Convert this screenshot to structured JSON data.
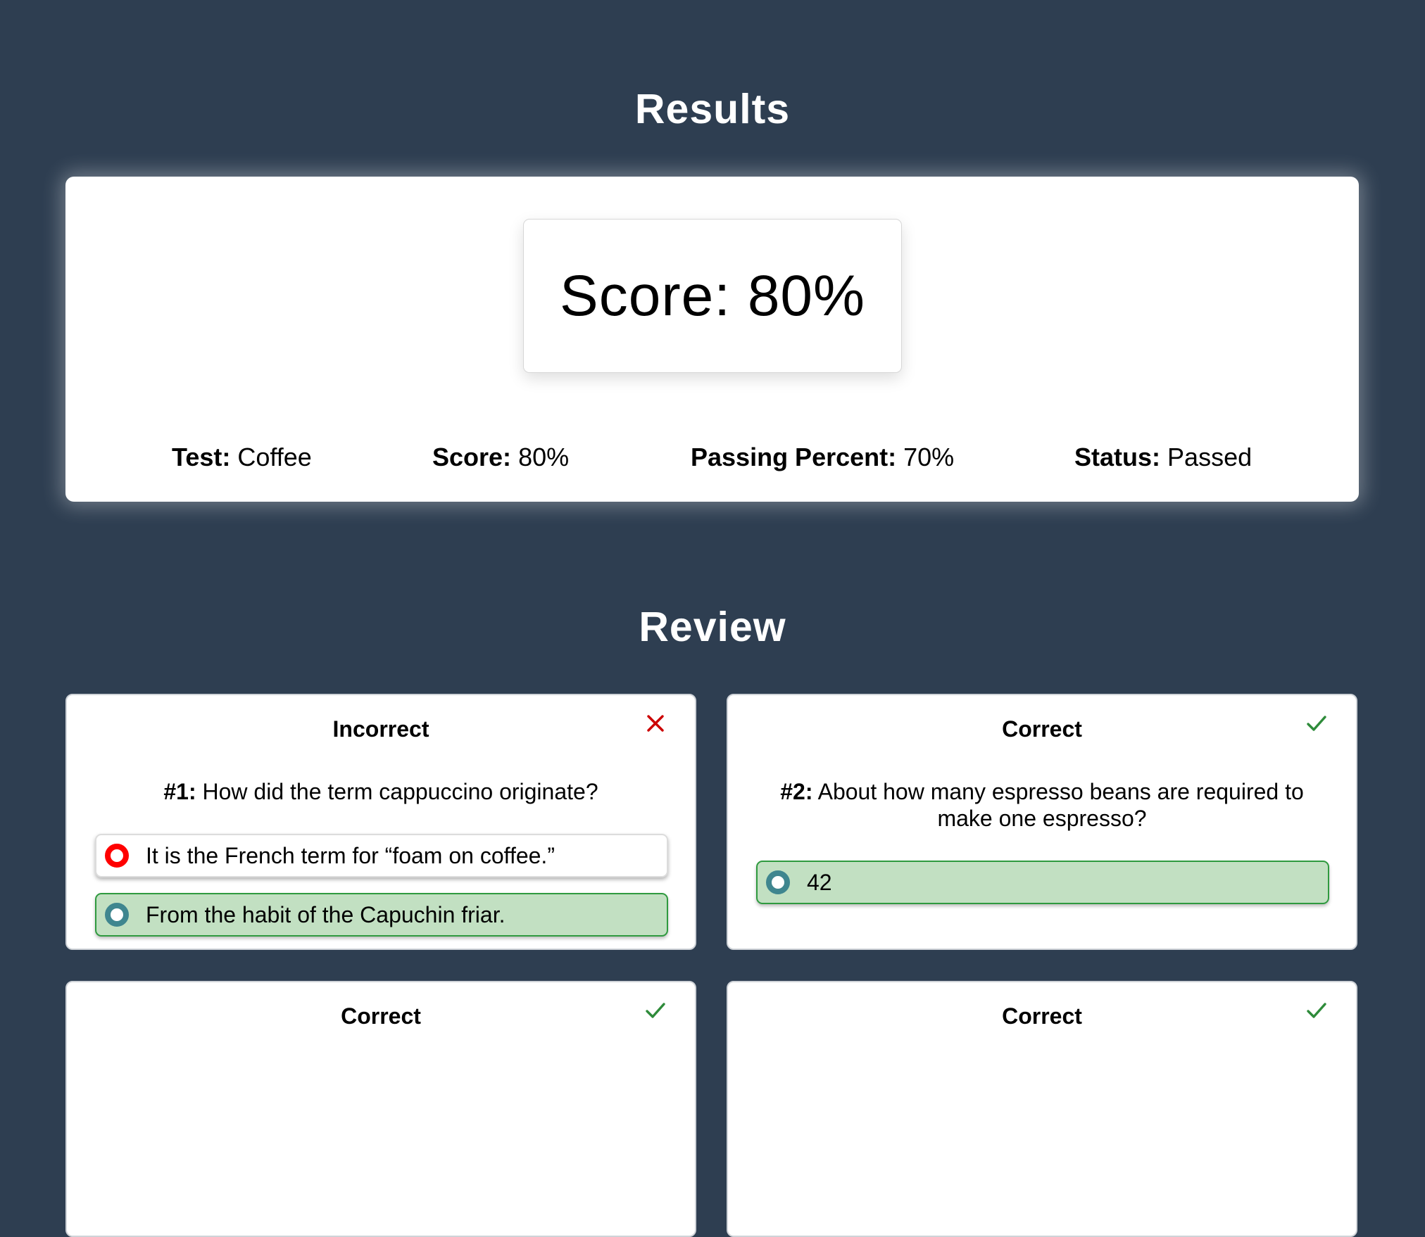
{
  "results_heading": "Results",
  "review_heading": "Review",
  "summary": {
    "score_display": "Score: 80%",
    "test_label": "Test:",
    "test_value": "Coffee",
    "score_label": "Score:",
    "score_value": "80%",
    "passing_label": "Passing Percent:",
    "passing_value": "70%",
    "status_label": "Status:",
    "status_value": "Passed"
  },
  "questions": [
    {
      "verdict": "Incorrect",
      "verdict_icon": "x-icon",
      "number": "#1:",
      "text": "How did the term cappuccino originate?",
      "options": [
        {
          "text": "It is the French term for “foam on coffee.”",
          "state": "selected-wrong"
        },
        {
          "text": "From the habit of the Capuchin friar.",
          "state": "correct-answer"
        }
      ]
    },
    {
      "verdict": "Correct",
      "verdict_icon": "check-icon",
      "number": "#2:",
      "text": "About how many espresso beans are required to make one espresso?",
      "options": [
        {
          "text": "42",
          "state": "correct-answer"
        }
      ]
    },
    {
      "verdict": "Correct",
      "verdict_icon": "check-icon"
    },
    {
      "verdict": "Correct",
      "verdict_icon": "check-icon"
    }
  ],
  "colors": {
    "background": "#2e3e51",
    "incorrect": "#cc0000",
    "correct": "#2e8b3a",
    "correct_fill": "#c2e0c2",
    "radio_teal": "#3f868f",
    "radio_red": "#ff0000"
  }
}
